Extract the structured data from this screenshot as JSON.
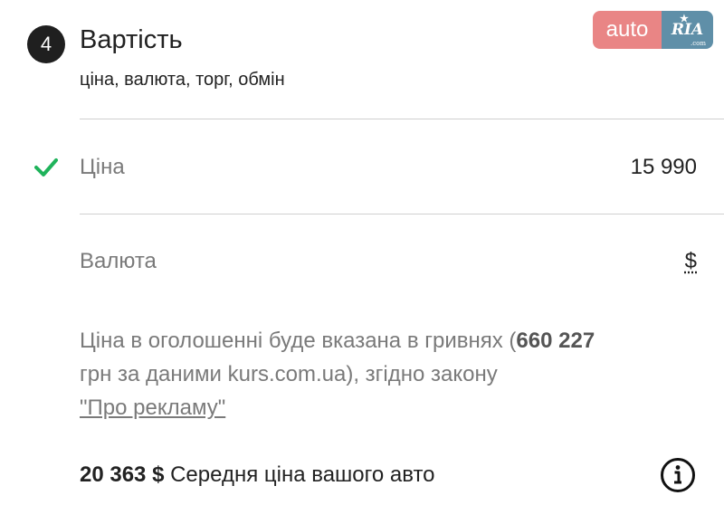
{
  "section": {
    "step": "4",
    "title": "Вартість",
    "subtitle": "ціна, валюта, торг, обмін"
  },
  "logo": {
    "part1": "auto",
    "part2": "RIA",
    "domain": ".com"
  },
  "price": {
    "label": "Ціна",
    "value": "15 990",
    "status_icon": "check-icon",
    "status_color": "#1fb35b"
  },
  "currency": {
    "label": "Валюта",
    "value": "$"
  },
  "notice": {
    "text_before": "Ціна в оголошенні буде вказана в гривнях (",
    "amount": "660 227",
    "text_after": "грн за даними kurs.com.ua), згідно закону",
    "link": "\"Про рекламу\""
  },
  "average": {
    "amount": "20 363 $",
    "text": "Середня ціна вашого авто",
    "icon": "info-icon"
  },
  "colors": {
    "badge": "#1f1f1f",
    "logo_auto": "#e98585",
    "logo_ria": "#5f8fa8",
    "muted_text": "#7a7a7a"
  }
}
